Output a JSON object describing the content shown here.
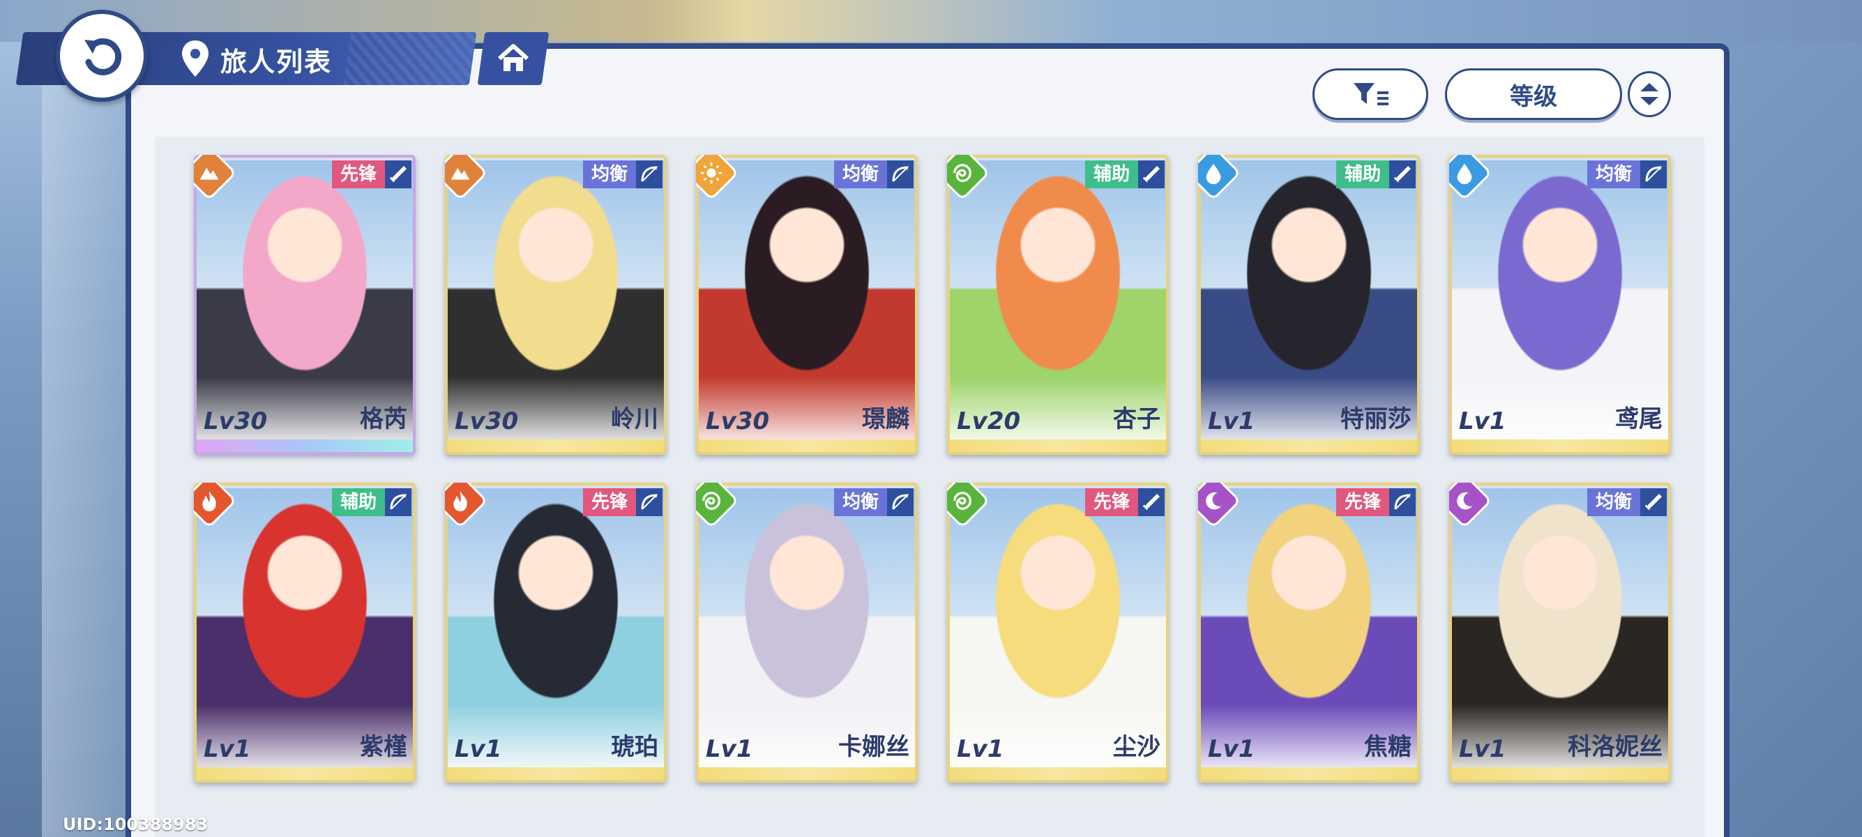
{
  "header": {
    "title": "旅人列表"
  },
  "toolbar": {
    "sort_label": "等级"
  },
  "characters": [
    {
      "name": "格芮",
      "level": "Lv30",
      "role": "先锋",
      "role_type": "vanguard",
      "element": "earth-icon",
      "weapon": "sword-icon",
      "rarity": "purple",
      "colors": [
        "#f3a7c9",
        "#3a3a48"
      ]
    },
    {
      "name": "岭川",
      "level": "Lv30",
      "role": "均衡",
      "role_type": "balance",
      "element": "earth-icon",
      "weapon": "bow-icon",
      "rarity": "gold",
      "colors": [
        "#f2dc8e",
        "#2f2f2f"
      ]
    },
    {
      "name": "璟麟",
      "level": "Lv30",
      "role": "均衡",
      "role_type": "balance",
      "element": "sun-icon",
      "weapon": "bow-icon",
      "rarity": "gold",
      "colors": [
        "#2a1c22",
        "#c23a2f"
      ]
    },
    {
      "name": "杏子",
      "level": "Lv20",
      "role": "辅助",
      "role_type": "support",
      "element": "wind-icon",
      "weapon": "sword-icon",
      "rarity": "gold",
      "colors": [
        "#f08b4c",
        "#9ed46a"
      ]
    },
    {
      "name": "特丽莎",
      "level": "Lv1",
      "role": "辅助",
      "role_type": "support",
      "element": "water-icon",
      "weapon": "sword-icon",
      "rarity": "gold",
      "colors": [
        "#26242c",
        "#3a4c86"
      ]
    },
    {
      "name": "鸢尾",
      "level": "Lv1",
      "role": "均衡",
      "role_type": "balance",
      "element": "water-icon",
      "weapon": "bow-icon",
      "rarity": "gold",
      "colors": [
        "#7a6ad0",
        "#f4f4f8"
      ]
    },
    {
      "name": "紫槿",
      "level": "Lv1",
      "role": "辅助",
      "role_type": "support",
      "element": "fire-icon",
      "weapon": "bow-icon",
      "rarity": "gold",
      "colors": [
        "#d8332f",
        "#4a2f6a"
      ]
    },
    {
      "name": "琥珀",
      "level": "Lv1",
      "role": "先锋",
      "role_type": "vanguard",
      "element": "fire-icon",
      "weapon": "bow-icon",
      "rarity": "gold",
      "colors": [
        "#252a35",
        "#8fd0e0"
      ]
    },
    {
      "name": "卡娜丝",
      "level": "Lv1",
      "role": "均衡",
      "role_type": "balance",
      "element": "wind-icon",
      "weapon": "bow-icon",
      "rarity": "gold",
      "colors": [
        "#c9c2da",
        "#f1f1f6"
      ]
    },
    {
      "name": "尘沙",
      "level": "Lv1",
      "role": "先锋",
      "role_type": "vanguard",
      "element": "wind-icon",
      "weapon": "sword-icon",
      "rarity": "gold",
      "colors": [
        "#f6dc7c",
        "#f6f6f2"
      ]
    },
    {
      "name": "焦糖",
      "level": "Lv1",
      "role": "先锋",
      "role_type": "vanguard",
      "element": "moon-icon",
      "weapon": "bow-icon",
      "rarity": "gold",
      "colors": [
        "#f2d27c",
        "#6a4bb8"
      ]
    },
    {
      "name": "科洛妮丝",
      "level": "Lv1",
      "role": "均衡",
      "role_type": "balance",
      "element": "moon-icon",
      "weapon": "sword-icon",
      "rarity": "gold",
      "colors": [
        "#efe3cc",
        "#2a2622"
      ]
    }
  ],
  "footer": {
    "uid": "UID:100388983"
  }
}
